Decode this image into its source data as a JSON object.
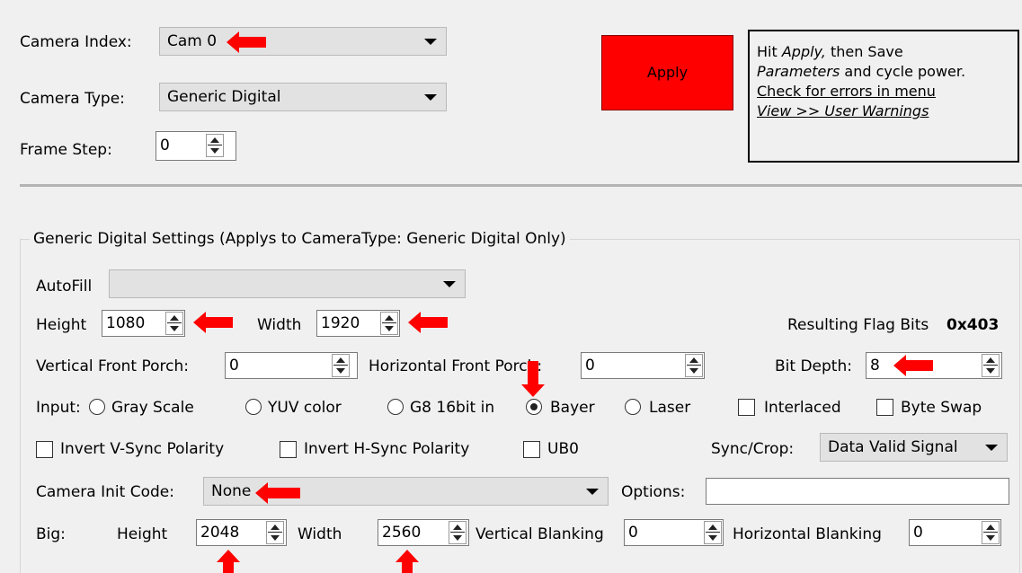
{
  "top": {
    "camera_index_label": "Camera Index:",
    "camera_index_value": "Cam 0",
    "camera_type_label": "Camera Type:",
    "camera_type_value": "Generic Digital",
    "frame_step_label": "Frame Step:",
    "frame_step_value": "0",
    "apply_label": "Apply",
    "apply_color": "#ff0000",
    "hint": {
      "line1_a": "Hit ",
      "line1_b": "Apply,",
      "line1_c": " then Save",
      "line2_a": "Parameters",
      "line2_b": " and cycle power.",
      "line3": "Check for errors in menu",
      "line4": "View >> User Warnings"
    }
  },
  "generic": {
    "group_title": "Generic Digital Settings (Applys to CameraType: Generic Digital Only)",
    "autofill_label": "AutoFill",
    "autofill_value": "",
    "height_label": "Height",
    "height_value": "1080",
    "width_label": "Width",
    "width_value": "1920",
    "flag_bits_label": "Resulting Flag Bits",
    "flag_bits_value": "0x403",
    "vfp_label": "Vertical Front Porch:",
    "vfp_value": "0",
    "hfp_label": "Horizontal Front Porch:",
    "hfp_value": "0",
    "bit_depth_label": "Bit Depth:",
    "bit_depth_value": "8",
    "input_label": "Input:",
    "input_options": [
      "Gray Scale",
      "YUV color",
      "G8 16bit in",
      "Bayer",
      "Laser"
    ],
    "input_selected": "Bayer",
    "interlaced_label": "Interlaced",
    "byte_swap_label": "Byte Swap",
    "invert_vsync_label": "Invert V-Sync Polarity",
    "invert_hsync_label": "Invert H-Sync Polarity",
    "ub0_label": "UB0",
    "sync_crop_label": "Sync/Crop:",
    "sync_crop_value": "Data Valid Signal",
    "init_code_label": "Camera Init Code:",
    "init_code_value": "None",
    "options_label": "Options:",
    "options_value": "",
    "big_label": "Big:",
    "big_height_label": "Height",
    "big_height_value": "2048",
    "big_width_label": "Width",
    "big_width_value": "2560",
    "vblank_label": "Vertical Blanking",
    "vblank_value": "0",
    "hblank_label": "Horizontal Blanking",
    "hblank_value": "0"
  },
  "annotation_color": "#ff0000"
}
